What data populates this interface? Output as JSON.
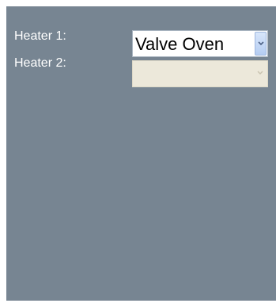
{
  "form": {
    "heater1": {
      "label": "Heater 1:",
      "selected": "Valve Oven",
      "enabled": true
    },
    "heater2": {
      "label": "Heater 2:",
      "selected": "",
      "enabled": false
    }
  },
  "colors": {
    "panel_background": "#778592",
    "label_text": "#ffffff",
    "disabled_field": "#ece8da",
    "dropdown_button": "#b5cdf2"
  },
  "icons": {
    "dropdown": "chevron-down-icon"
  }
}
